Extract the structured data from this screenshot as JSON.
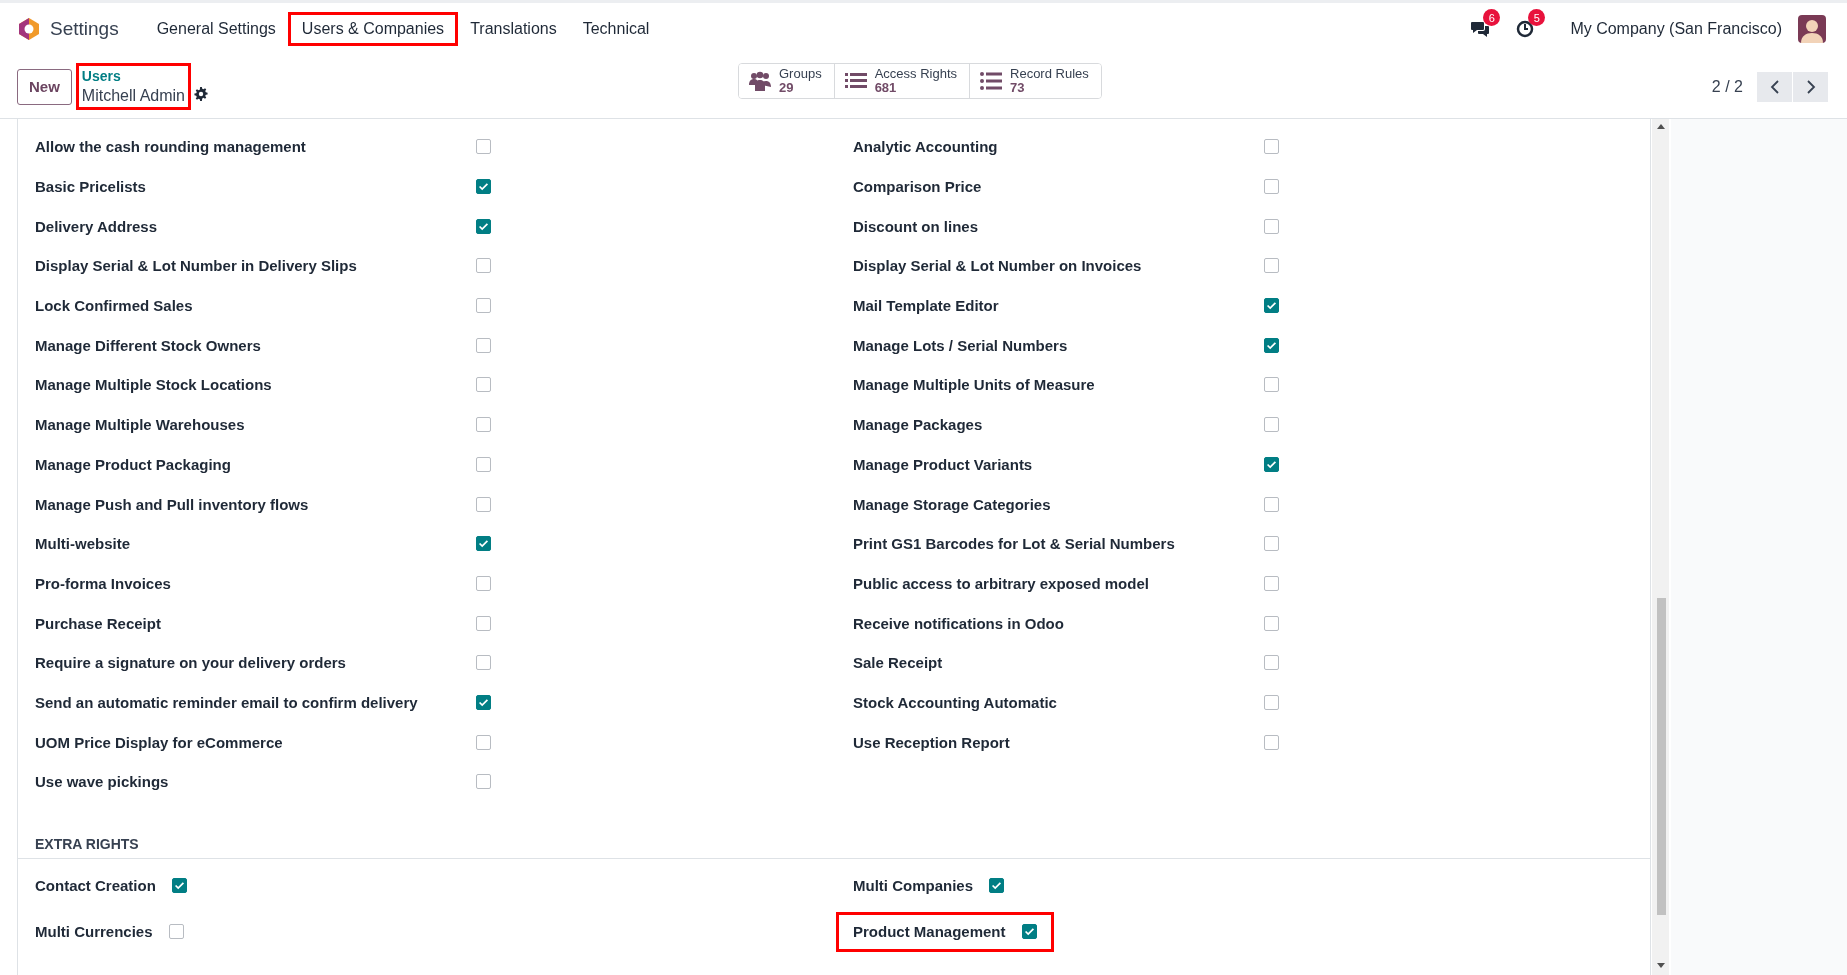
{
  "navbar": {
    "app_title": "Settings",
    "menu": [
      {
        "label": "General Settings",
        "highlighted": false
      },
      {
        "label": "Users & Companies",
        "highlighted": true
      },
      {
        "label": "Translations",
        "highlighted": false
      },
      {
        "label": "Technical",
        "highlighted": false
      }
    ],
    "messages_badge": "6",
    "activities_badge": "5",
    "company": "My Company (San Francisco)"
  },
  "control_panel": {
    "new_button": "New",
    "breadcrumb": {
      "parent": "Users",
      "current": "Mitchell Admin",
      "highlighted": true
    },
    "stat_buttons": [
      {
        "kind": "groups",
        "label": "Groups",
        "value": "29"
      },
      {
        "kind": "list",
        "label": "Access Rights",
        "value": "681"
      },
      {
        "kind": "bullets",
        "label": "Record Rules",
        "value": "73"
      }
    ],
    "pager": "2 / 2"
  },
  "rights_columns": [
    {
      "items": [
        {
          "label": "Allow the cash rounding management",
          "checked": false
        },
        {
          "label": "Basic Pricelists",
          "checked": true
        },
        {
          "label": "Delivery Address",
          "checked": true
        },
        {
          "label": "Display Serial & Lot Number in Delivery Slips",
          "checked": false
        },
        {
          "label": "Lock Confirmed Sales",
          "checked": false
        },
        {
          "label": "Manage Different Stock Owners",
          "checked": false
        },
        {
          "label": "Manage Multiple Stock Locations",
          "checked": false
        },
        {
          "label": "Manage Multiple Warehouses",
          "checked": false
        },
        {
          "label": "Manage Product Packaging",
          "checked": false
        },
        {
          "label": "Manage Push and Pull inventory flows",
          "checked": false
        },
        {
          "label": "Multi-website",
          "checked": true
        },
        {
          "label": "Pro-forma Invoices",
          "checked": false
        },
        {
          "label": "Purchase Receipt",
          "checked": false
        },
        {
          "label": "Require a signature on your delivery orders",
          "checked": false
        },
        {
          "label": "Send an automatic reminder email to confirm delivery",
          "checked": true
        },
        {
          "label": "UOM Price Display for eCommerce",
          "checked": false
        },
        {
          "label": "Use wave pickings",
          "checked": false
        }
      ]
    },
    {
      "items": [
        {
          "label": "Analytic Accounting",
          "checked": false
        },
        {
          "label": "Comparison Price",
          "checked": false
        },
        {
          "label": "Discount on lines",
          "checked": false
        },
        {
          "label": "Display Serial & Lot Number on Invoices",
          "checked": false
        },
        {
          "label": "Mail Template Editor",
          "checked": true
        },
        {
          "label": "Manage Lots / Serial Numbers",
          "checked": true
        },
        {
          "label": "Manage Multiple Units of Measure",
          "checked": false
        },
        {
          "label": "Manage Packages",
          "checked": false
        },
        {
          "label": "Manage Product Variants",
          "checked": true
        },
        {
          "label": "Manage Storage Categories",
          "checked": false
        },
        {
          "label": "Print GS1 Barcodes for Lot & Serial Numbers",
          "checked": false
        },
        {
          "label": "Public access to arbitrary exposed model",
          "checked": false
        },
        {
          "label": "Receive notifications in Odoo",
          "checked": false
        },
        {
          "label": "Sale Receipt",
          "checked": false
        },
        {
          "label": "Stock Accounting Automatic",
          "checked": false
        },
        {
          "label": "Use Reception Report",
          "checked": false
        }
      ]
    }
  ],
  "extra_rights": {
    "title": "EXTRA RIGHTS",
    "columns": [
      {
        "items": [
          {
            "label": "Contact Creation",
            "checked": true,
            "highlighted": false
          },
          {
            "label": "Multi Currencies",
            "checked": false,
            "highlighted": false
          }
        ]
      },
      {
        "items": [
          {
            "label": "Multi Companies",
            "checked": true,
            "highlighted": false
          },
          {
            "label": "Product Management",
            "checked": true,
            "highlighted": true
          }
        ]
      }
    ]
  }
}
